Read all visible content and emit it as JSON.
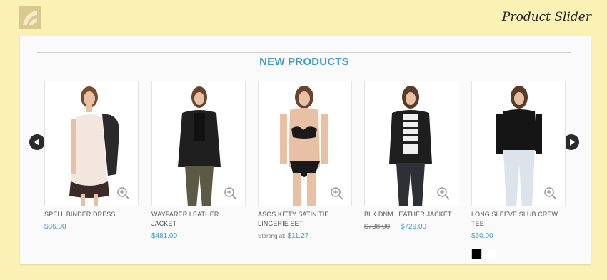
{
  "header": {
    "title": "Product Slider"
  },
  "section": {
    "title": "NEW PRODUCTS"
  },
  "products": [
    {
      "name": "SPELL BINDER DRESS",
      "price": "$86.00"
    },
    {
      "name": "WAYFARER LEATHER JACKET",
      "price": "$481.00"
    },
    {
      "name": "ASOS KITTY SATIN TIE LINGERIE SET",
      "starting_label": "Starting at:",
      "price": "$11.27"
    },
    {
      "name": "BLK DNM LEATHER JACKET",
      "old_price": "$738.00",
      "price": "$729.00"
    },
    {
      "name": "LONG SLEEVE SLUB CREW TEE",
      "price": "$60.00",
      "swatches": [
        "#000000",
        "#ffffff"
      ]
    }
  ],
  "colors": {
    "background": "#fbf1b5",
    "accent": "#3d9bc8",
    "panel": "#fafafa"
  },
  "icons": {
    "prev": "chevron-left-icon",
    "next": "chevron-right-icon",
    "zoom": "zoom-in-icon"
  }
}
